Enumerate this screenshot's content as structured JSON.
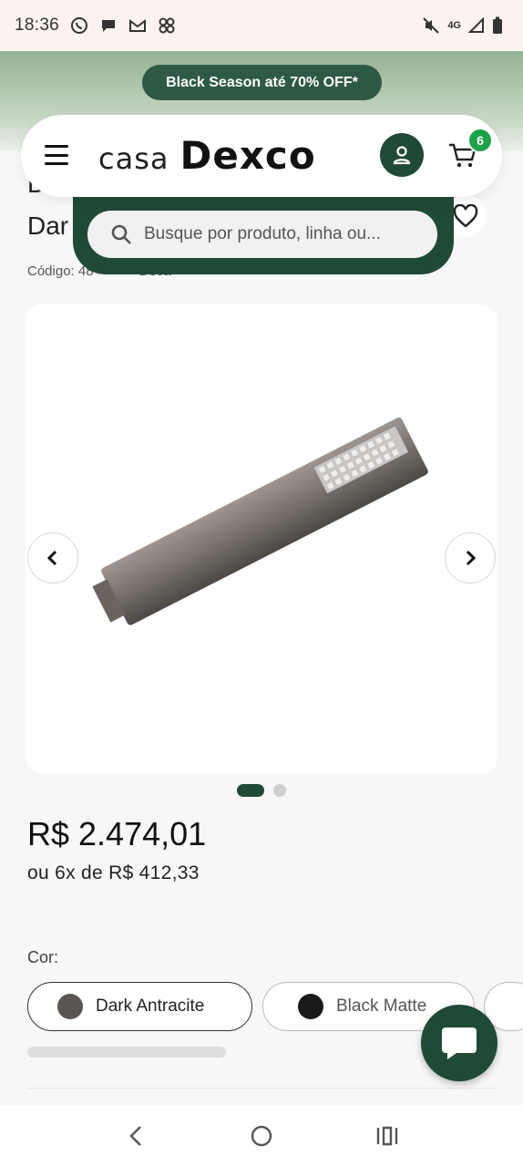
{
  "status_bar": {
    "time": "18:36",
    "notifications": [
      "whatsapp-icon",
      "chat-icon",
      "gmail-icon",
      "pinwheel-icon"
    ],
    "network": "4G",
    "system_icons": [
      "mute-icon",
      "signal-icon",
      "battery-icon"
    ]
  },
  "promo": {
    "text": "Black Season até 70% OFF*"
  },
  "header": {
    "logo_casa": "casa",
    "logo_brand": "Dexco",
    "cart_count": "6"
  },
  "search": {
    "placeholder": "Busque por produto, linha ou..."
  },
  "product": {
    "title_line1": "Du",
    "title_line2": "Dar",
    "code_label": "Código: 48",
    "brand_partial": "Deca",
    "price": "R$ 2.474,01",
    "installments": "ou 6x de R$ 412,33",
    "color_label": "Cor:",
    "colors": [
      {
        "name": "Dark Antracite",
        "swatch": "#5b5552",
        "selected": true
      },
      {
        "name": "Black Matte",
        "swatch": "#1a1a1a",
        "selected": false
      }
    ],
    "gallery": {
      "current": 1,
      "total": 2
    }
  },
  "colors": {
    "primary": "#1f4a36",
    "badge": "#1da24a",
    "promo_bg": "#2e5a44"
  }
}
